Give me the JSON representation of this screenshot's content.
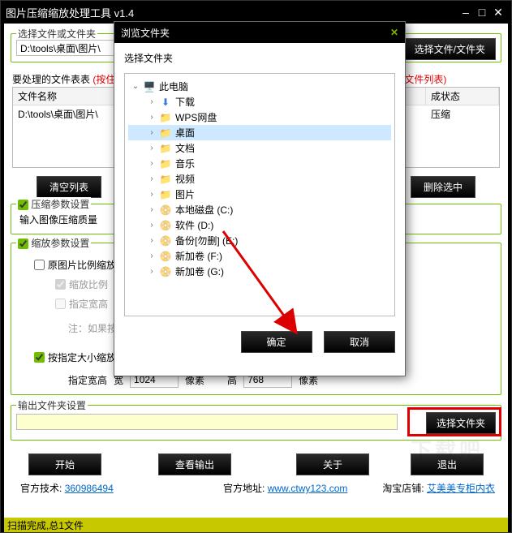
{
  "title": "图片压缩缩放处理工具 v1.4",
  "group_select": "选择文件或文件夹",
  "path_input": "D:\\tools\\桌面\\图片\\",
  "btn_select_file": "选择文件/文件夹",
  "list_title_prefix": "要处理的文件表表",
  "list_title_red": "(按住ctrl重复点击可多选文件)然后按删除选中按钮即可移除选中的文件到文件列表)",
  "col_filename": "文件名称",
  "col_status": "成状态",
  "row1_path": "D:\\tools\\桌面\\图片\\",
  "row1_status": "压缩",
  "btn_clear": "清空列表",
  "btn_delete": "删除选中",
  "grp_compress": "压缩参数设置",
  "compress_label": "输入图像压缩质量",
  "grp_scale": "缩放参数设置",
  "chk_ratio": "原图片比例缩放",
  "chk_ratio2": "缩放比例",
  "chk_width": "指定宽高",
  "note_gray": "注：如果按比",
  "chk_size": "按指定大小缩放",
  "size_label": "指定宽高",
  "w_label": "宽",
  "w_val": "1024",
  "h_label": "高",
  "h_val": "768",
  "px": "像素",
  "grp_output": "输出文件夹设置",
  "btn_select_folder": "选择文件夹",
  "btn_start": "开始",
  "btn_view": "查看输出",
  "btn_about": "关于",
  "btn_exit": "退出",
  "tech_label": "官方技术:",
  "tech_link": "360986494",
  "addr_label": "官方地址:",
  "addr_link": "www.ctwy123.com",
  "shop_label": "淘宝店铺:",
  "shop_link": "艾美美专柜内衣",
  "statusbar": "扫描完成,总1文件",
  "modal": {
    "title": "浏览文件夹",
    "subtitle": "选择文件夹",
    "ok": "确定",
    "cancel": "取消",
    "items": [
      {
        "icon": "pc",
        "label": "此电脑",
        "indent": 0,
        "expanded": true
      },
      {
        "icon": "dl",
        "label": "下载",
        "indent": 1
      },
      {
        "icon": "folder",
        "label": "WPS网盘",
        "indent": 1
      },
      {
        "icon": "folder",
        "label": "桌面",
        "indent": 1,
        "selected": true
      },
      {
        "icon": "folder",
        "label": "文档",
        "indent": 1
      },
      {
        "icon": "folder",
        "label": "音乐",
        "indent": 1
      },
      {
        "icon": "folder",
        "label": "视频",
        "indent": 1
      },
      {
        "icon": "folder",
        "label": "图片",
        "indent": 1
      },
      {
        "icon": "drive",
        "label": "本地磁盘 (C:)",
        "indent": 1
      },
      {
        "icon": "drive",
        "label": "软件 (D:)",
        "indent": 1
      },
      {
        "icon": "drive",
        "label": "备份[勿删] (E:)",
        "indent": 1
      },
      {
        "icon": "drive",
        "label": "新加卷 (F:)",
        "indent": 1
      },
      {
        "icon": "drive",
        "label": "新加卷 (G:)",
        "indent": 1
      }
    ]
  }
}
